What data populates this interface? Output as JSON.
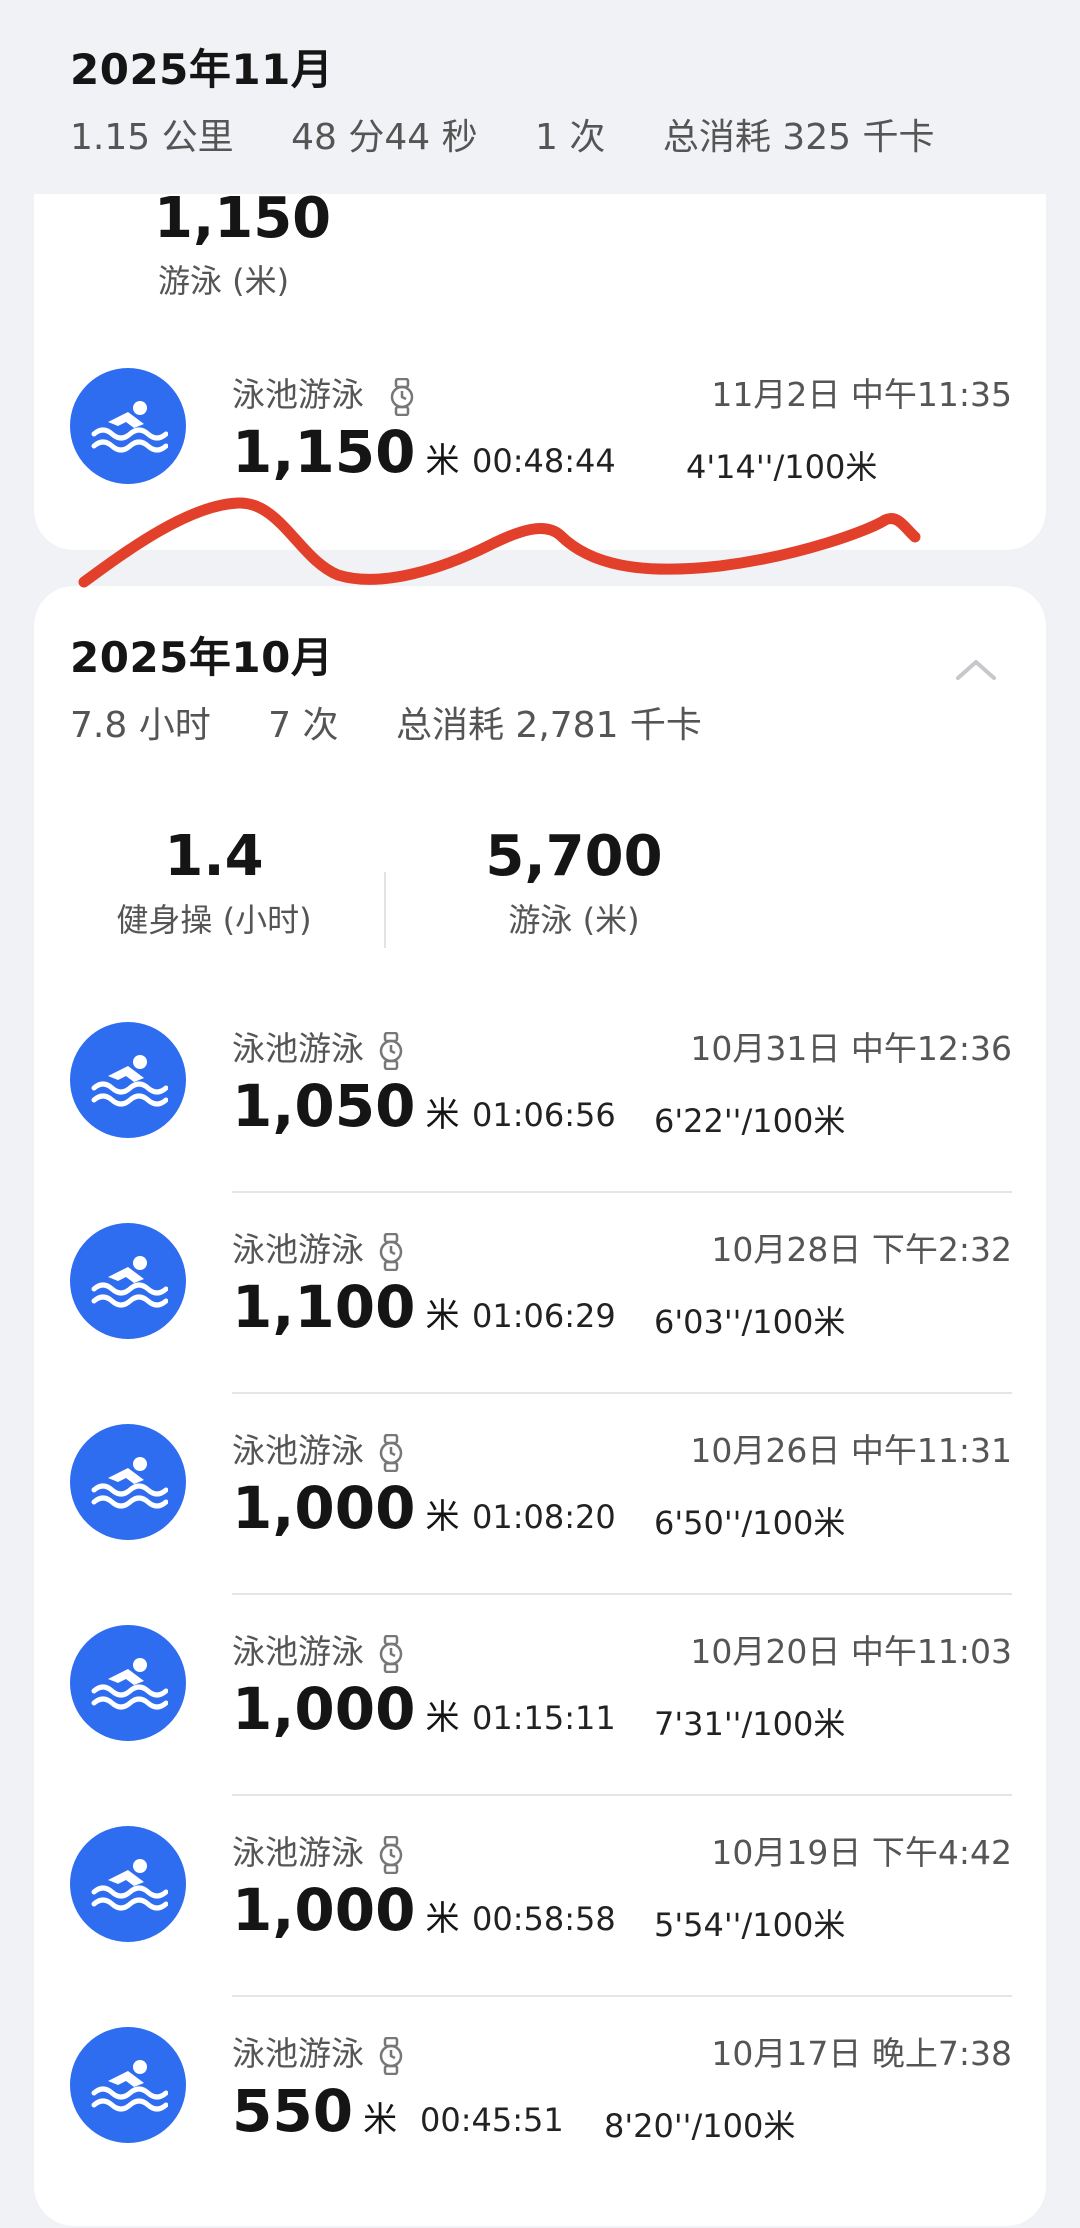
{
  "november": {
    "title": "2025年11月",
    "summary": {
      "distance": "1.15 公里",
      "duration": "48 分44 秒",
      "count": "1 次",
      "calories": "总消耗 325 千卡"
    },
    "stat": {
      "value": "1,150",
      "label": "游泳 (米)"
    },
    "activities": [
      {
        "name": "泳池游泳",
        "date": "11月2日 中午11:35",
        "distance": "1,150",
        "unit": "米",
        "duration": "00:48:44",
        "pace": "4'14''/100米"
      }
    ]
  },
  "october": {
    "title": "2025年10月",
    "summary": {
      "hours": "7.8 小时",
      "count": "7 次",
      "calories": "总消耗 2,781 千卡"
    },
    "stats": [
      {
        "value": "1.4",
        "label": "健身操 (小时)"
      },
      {
        "value": "5,700",
        "label": "游泳 (米)"
      }
    ],
    "activities": [
      {
        "name": "泳池游泳",
        "date": "10月31日 中午12:36",
        "distance": "1,050",
        "unit": "米",
        "duration": "01:06:56",
        "pace": "6'22''/100米"
      },
      {
        "name": "泳池游泳",
        "date": "10月28日 下午2:32",
        "distance": "1,100",
        "unit": "米",
        "duration": "01:06:29",
        "pace": "6'03''/100米"
      },
      {
        "name": "泳池游泳",
        "date": "10月26日 中午11:31",
        "distance": "1,000",
        "unit": "米",
        "duration": "01:08:20",
        "pace": "6'50''/100米"
      },
      {
        "name": "泳池游泳",
        "date": "10月20日 中午11:03",
        "distance": "1,000",
        "unit": "米",
        "duration": "01:15:11",
        "pace": "7'31''/100米"
      },
      {
        "name": "泳池游泳",
        "date": "10月19日 下午4:42",
        "distance": "1,000",
        "unit": "米",
        "duration": "00:58:58",
        "pace": "5'54''/100米"
      },
      {
        "name": "泳池游泳",
        "date": "10月17日 晚上7:38",
        "distance": "550",
        "unit": "米",
        "duration": "00:45:51",
        "pace": "8'20''/100米"
      }
    ]
  },
  "icons": {
    "activity": "swimmer-icon",
    "device": "watch-icon",
    "collapse": "chevron-up-icon"
  },
  "colors": {
    "accent": "#2f6df0",
    "background": "#f1f2f5",
    "annotation": "#e2402a"
  }
}
